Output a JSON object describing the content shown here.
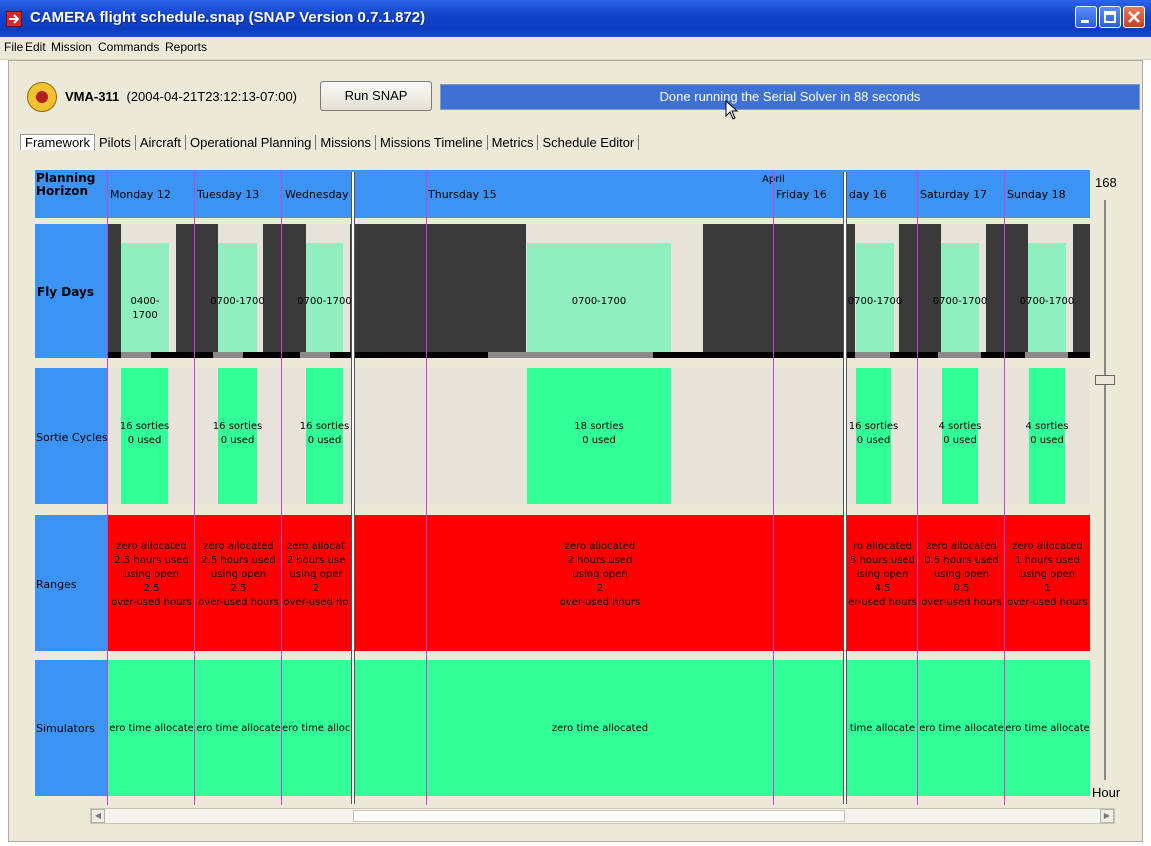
{
  "window": {
    "title": "CAMERA flight schedule.snap (SNAP Version 0.7.1.872)",
    "app_icon": "camera-app-icon"
  },
  "menu": [
    "File",
    "Edit",
    "Mission",
    "Commands",
    "Reports"
  ],
  "toolbar": {
    "unit_name": "VMA-311",
    "timestamp": "(2004-04-21T23:12:13-07:00)",
    "run_label": "Run SNAP",
    "status": "Done running the Serial Solver in 88 seconds"
  },
  "tabs": [
    "Framework",
    "Pilots",
    "Aircraft",
    "Operational Planning",
    "Missions",
    "Missions Timeline",
    "Metrics",
    "Schedule Editor"
  ],
  "active_tab": "Framework",
  "grid": {
    "row_labels": {
      "planning_horizon": "Planning Horizon",
      "fly_days": "Fly Days",
      "sortie_cycles": "Sortie Cycles",
      "ranges": "Ranges",
      "simulators": "Simulators"
    },
    "month": "April",
    "days": [
      "Monday 12",
      "Tuesday 13",
      "Wednesday 1",
      "Thursday 15",
      "Friday 16",
      "day 16",
      "Saturday 17",
      "Sunday 18"
    ],
    "fly_hours": [
      "0400-1700",
      "0700-1700",
      "0700-1700",
      "0700-1700",
      "0700-1700",
      "0700-1700",
      "0700-1700"
    ],
    "sorties": [
      {
        "line1": "16 sorties",
        "line2": "0 used"
      },
      {
        "line1": "16 sorties",
        "line2": "0 used"
      },
      {
        "line1": "16 sorties",
        "line2": "0 used"
      },
      {
        "line1": "18 sorties",
        "line2": "0 used"
      },
      {
        "line1": "16 sorties",
        "line2": "0 used"
      },
      {
        "line1": "4 sorties",
        "line2": "0 used"
      },
      {
        "line1": "4 sorties",
        "line2": "0 used"
      }
    ],
    "ranges": [
      {
        "l1": "zero allocated",
        "l2": "2.5 hours used",
        "l3": "using open",
        "l4": "2.5",
        "l5": "over-used hours"
      },
      {
        "l1": "zero allocated",
        "l2": "2.5 hours used",
        "l3": "using open",
        "l4": "2.5",
        "l5": "over-used hours"
      },
      {
        "l1": "zero allocat",
        "l2": "2 hours use",
        "l3": "using oper",
        "l4": "2",
        "l5": "over-used ho"
      },
      {
        "l1": "zero allocated",
        "l2": "2 hours used",
        "l3": "using open",
        "l4": "2",
        "l5": "over-used hours"
      },
      {
        "l1": "ro allocated",
        "l2": "5 hours used",
        "l3": "ising open",
        "l4": "4.5",
        "l5": "er-used hours"
      },
      {
        "l1": "zero allocated",
        "l2": "0.5 hours used",
        "l3": "using open",
        "l4": "0.5",
        "l5": "over-used hours"
      },
      {
        "l1": "zero allocated",
        "l2": "1 hours used",
        "l3": "using open",
        "l4": "1",
        "l5": "over-used hours"
      }
    ],
    "simulators": [
      "ero time allocate",
      "ero time allocate",
      "ero time alloc",
      "zero time allocated",
      "time allocate",
      "ero time allocate",
      "ero time allocate"
    ],
    "slider_max": "168",
    "slider_unit": "Hour",
    "colors": {
      "header_blue": "#3b93f3",
      "fly_green": "#8fefbf",
      "sortie_green": "#33ff99",
      "range_red": "#ff0000",
      "sim_green": "#33ff99",
      "night_dark": "#3a3a3a",
      "day_line": "#cc44cc"
    }
  }
}
